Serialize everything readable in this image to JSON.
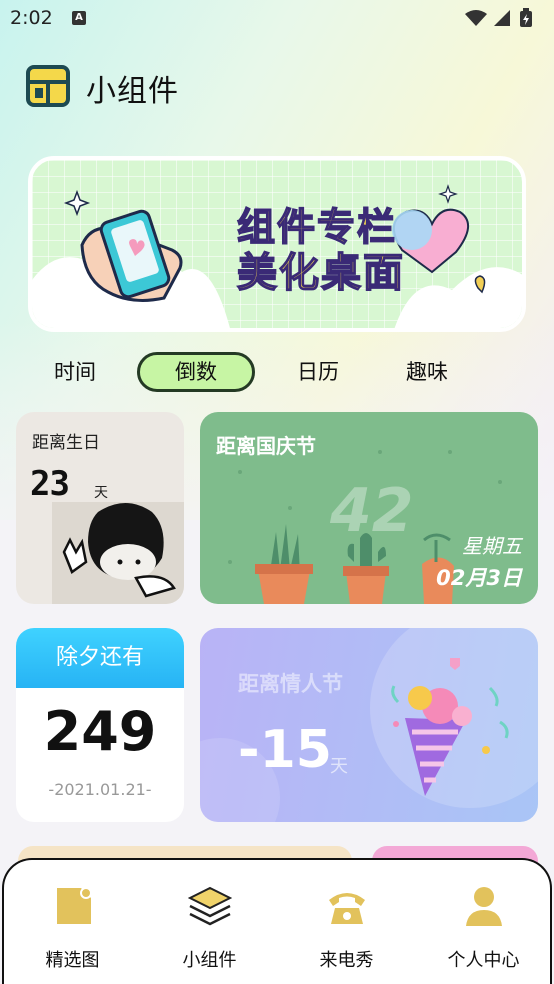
{
  "status_bar": {
    "time": "2:02",
    "notification_icon": "A",
    "icons": [
      "wifi-icon",
      "signal-icon",
      "battery-icon"
    ]
  },
  "header": {
    "title": "小组件",
    "logo_icon": "widget-logo-icon"
  },
  "banner": {
    "line1": "组件专栏",
    "line2": "美化桌面",
    "icons": [
      "phone-hand-icon",
      "heart-bubble-icon",
      "sparkle-icon"
    ]
  },
  "tabs": [
    {
      "label": "时间",
      "active": false
    },
    {
      "label": "倒数",
      "active": true
    },
    {
      "label": "日历",
      "active": false
    },
    {
      "label": "趣味",
      "active": false
    }
  ],
  "cards": {
    "birthday": {
      "label": "距离生日",
      "number": "23",
      "unit": "天"
    },
    "national_day": {
      "label": "距离国庆节",
      "number": "42",
      "weekday": "星期五",
      "date": "02月3日"
    },
    "new_year_eve": {
      "label": "除夕还有",
      "number": "249",
      "date": "-2021.01.21-"
    },
    "valentine": {
      "label": "距离情人节",
      "number": "-15",
      "unit": "天"
    }
  },
  "bottom_nav": [
    {
      "label": "精选图",
      "icon": "featured-image-icon"
    },
    {
      "label": "小组件",
      "icon": "widget-layers-icon",
      "active": true
    },
    {
      "label": "来电秀",
      "icon": "phone-icon"
    },
    {
      "label": "个人中心",
      "icon": "user-icon"
    }
  ],
  "colors": {
    "accent_green": "#c7f5a4",
    "icon_gold": "#e2c25c",
    "card_green": "#7fbc8c",
    "card_blue": "#27b3f4",
    "card_purple": "#b9b3f6"
  }
}
